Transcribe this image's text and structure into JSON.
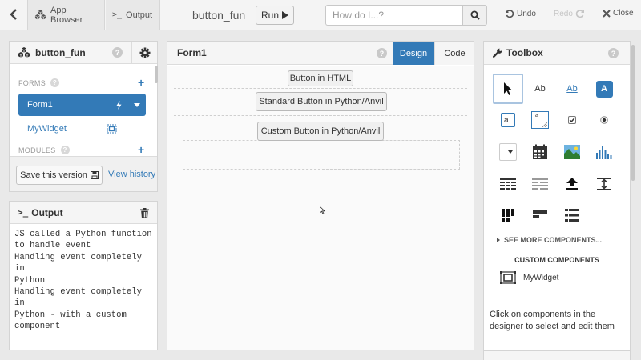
{
  "topbar": {
    "app_browser_label": "App Browser",
    "output_label": "Output",
    "app_name": "button_fun",
    "run_label": "Run",
    "search_placeholder": "How do I...?",
    "undo_label": "Undo",
    "redo_label": "Redo",
    "close_label": "Close"
  },
  "app_panel": {
    "title": "button_fun",
    "forms_label": "FORMS",
    "forms": [
      {
        "label": "Form1",
        "selected": true
      },
      {
        "label": "MyWidget",
        "selected": false
      }
    ],
    "modules_label": "MODULES",
    "save_label": "Save this version",
    "history_label": "View history"
  },
  "output_panel": {
    "title": "Output",
    "text": "JS called a Python function\nto handle event\nHandling event completely in\nPython\nHandling event completely in\nPython - with a custom\ncomponent"
  },
  "design_panel": {
    "title": "Form1",
    "design_tab": "Design",
    "code_tab": "Code",
    "buttons": {
      "html": "Button in HTML",
      "anvil": "Standard Button in Python/Anvil",
      "custom": "Custom Button in Python/Anvil"
    }
  },
  "toolbox": {
    "title": "Toolbox",
    "tools": [
      {
        "icon": "pointer-icon",
        "label": ""
      },
      {
        "icon": "label-icon",
        "label": "Ab"
      },
      {
        "icon": "link-icon",
        "label": "Ab"
      },
      {
        "icon": "button-icon",
        "label": "A"
      },
      {
        "icon": "textbox-icon",
        "label": "a"
      },
      {
        "icon": "textarea-icon",
        "label": "a"
      },
      {
        "icon": "checkbox-icon",
        "label": ""
      },
      {
        "icon": "radio-button-icon",
        "label": ""
      },
      {
        "icon": "dropdown-icon",
        "label": ""
      },
      {
        "icon": "calendar-icon",
        "label": ""
      },
      {
        "icon": "image-icon",
        "label": ""
      },
      {
        "icon": "plot-icon",
        "label": ""
      },
      {
        "icon": "data-grid-icon",
        "label": ""
      },
      {
        "icon": "repeating-panel-icon",
        "label": ""
      },
      {
        "icon": "file-loader-icon",
        "label": ""
      },
      {
        "icon": "spacer-icon",
        "label": ""
      },
      {
        "icon": "column-panel-icon",
        "label": ""
      },
      {
        "icon": "flow-panel-icon",
        "label": ""
      },
      {
        "icon": "linear-panel-icon",
        "label": ""
      }
    ],
    "see_more_label": "SEE MORE COMPONENTS...",
    "custom_header": "CUSTOM COMPONENTS",
    "custom_item": "MyWidget",
    "footer_text": "Click on components in the designer to select and edit them"
  },
  "colors": {
    "accent": "#337ab7",
    "panel_header_bg": "#f5f5f5",
    "background": "#e9e9e9"
  }
}
